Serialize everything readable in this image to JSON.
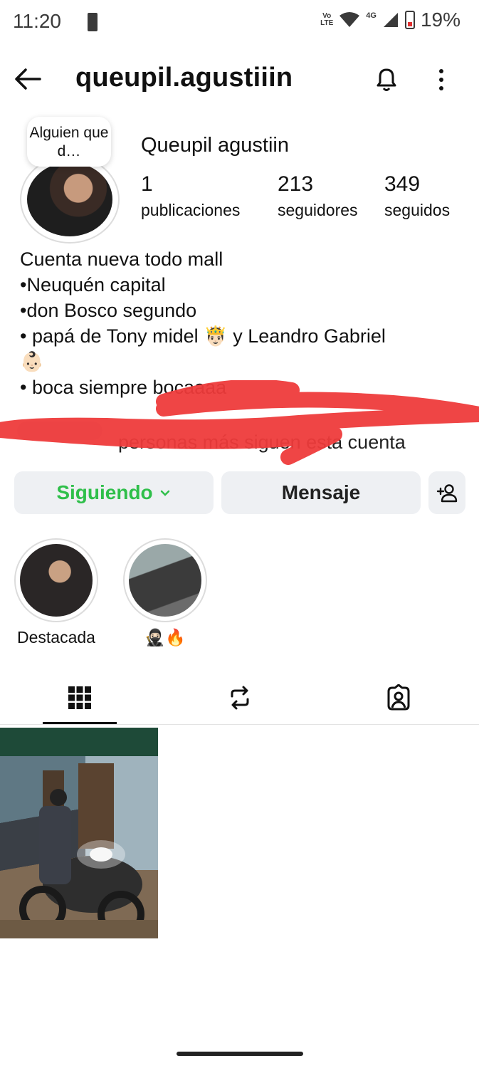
{
  "status_bar": {
    "time": "11:20",
    "network_badge": "Vo LTE",
    "network_type": "4G",
    "battery": "19%",
    "icons": [
      "alert-icon",
      "wifi-icon",
      "signal-icon",
      "battery-icon"
    ]
  },
  "header": {
    "username": "queupil.agustiiin",
    "icons": [
      "back-arrow-icon",
      "bell-icon",
      "more-vertical-icon"
    ]
  },
  "profile": {
    "note": "Alguien que d…",
    "full_name": "Queupil agustiin",
    "stats": [
      {
        "value": "1",
        "label": "publicaciones"
      },
      {
        "value": "213",
        "label": "seguidores"
      },
      {
        "value": "349",
        "label": "seguidos"
      }
    ],
    "bio": "Cuenta nueva todo mall\n•Neuquén capital\n•don Bosco segundo\n• papá de Tony midel 🤴🏻 y Leandro Gabriel\n👶🏻\n• boca siempre bocaaaa",
    "followed_by_text": "personas más siguen esta cuenta"
  },
  "actions": {
    "following_label": "Siguiendo",
    "message_label": "Mensaje"
  },
  "highlights": [
    {
      "label": "Destacada"
    },
    {
      "label": "🥷🏻🔥"
    }
  ],
  "tabs": [
    "grid-icon",
    "reels-icon",
    "tagged-icon"
  ],
  "colors": {
    "following_green": "#2fbf4a",
    "button_bg": "#eef0f3",
    "redaction_red": "#ee3b3b"
  }
}
